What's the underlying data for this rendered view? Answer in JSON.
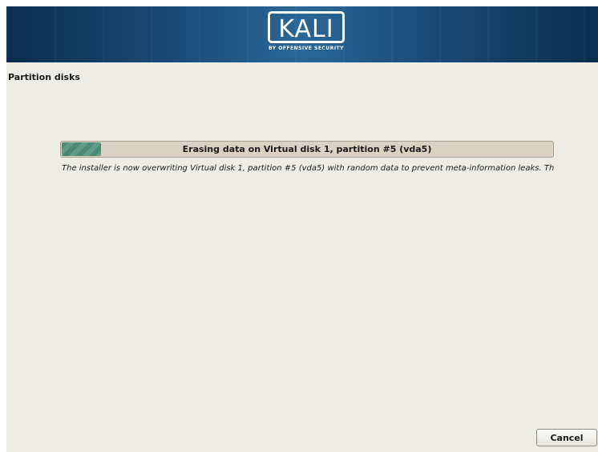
{
  "banner": {
    "logo_text": "KALI",
    "logo_subtitle": "BY OFFENSIVE SECURITY",
    "colors": {
      "dark": "#0b2e52",
      "light": "#2a6796"
    }
  },
  "page": {
    "title": "Partition disks"
  },
  "progress": {
    "label": "Erasing data on Virtual disk 1, partition #5 (vda5)",
    "description": "The installer is now overwriting Virtual disk 1, partition #5 (vda5) with random data to prevent meta-information leaks. This step may be skipped by cancelling this action, at the expense of the quality of the encryption.",
    "fraction": 0.08,
    "fill_color": "#4b8a76"
  },
  "buttons": {
    "cancel_label": "Cancel"
  }
}
